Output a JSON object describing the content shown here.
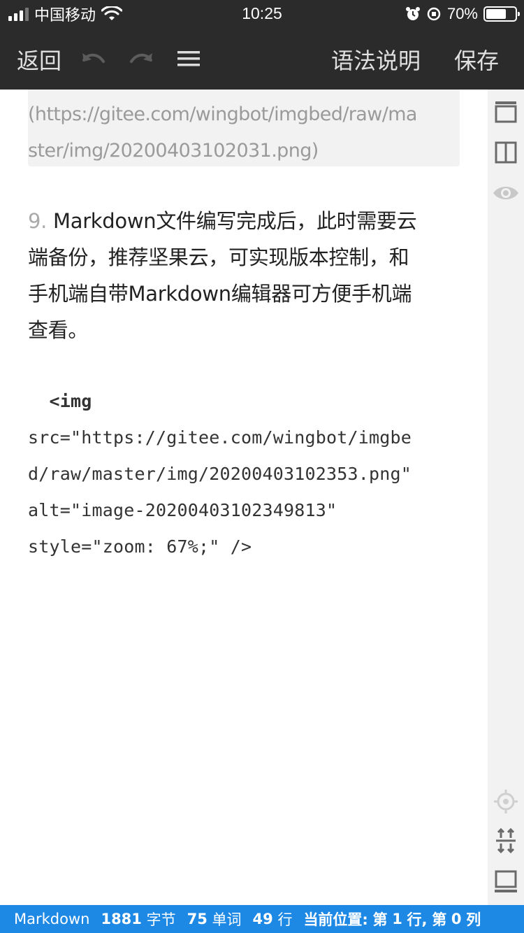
{
  "status_bar": {
    "carrier": "中国移动",
    "time": "10:25",
    "battery": "70%",
    "battery_level": 0.7
  },
  "toolbar": {
    "back_label": "返回",
    "syntax_label": "语法说明",
    "save_label": "保存"
  },
  "editor": {
    "link_lines": [
      "(https://gitee.com/wingbot/imgbed/raw/ma",
      "ster/img/20200403102031.png)"
    ],
    "paragraph": {
      "number": "9.",
      "lines": [
        " Markdown文件编写完成后，此时需要云",
        "端备份，推荐坚果云，可实现版本控制，和",
        "手机端自带Markdown编辑器可方便手机端",
        "查看。"
      ]
    },
    "code": {
      "tag": "<img",
      "lines": [
        "src=\"https://gitee.com/wingbot/imgbe",
        "d/raw/master/img/20200403102353.png\"",
        "alt=\"image-20200403102349813\"",
        "style=\"zoom: 67%;\" />"
      ]
    }
  },
  "footer": {
    "mode": "Markdown",
    "bytes_value": "1881",
    "bytes_label": "字节",
    "words_value": "75",
    "words_label": "单词",
    "lines_value": "49",
    "lines_label": "行",
    "position_label": "当前位置:",
    "position_row_prefix": "第",
    "position_row_value": "1",
    "position_row_suffix": "行,",
    "position_col_prefix": "第",
    "position_col_value": "0",
    "position_col_suffix": "列"
  },
  "colors": {
    "toolbar_bg": "#2b2b2b",
    "footer_bg": "#1e88e5",
    "side_bg": "#f2f2f2"
  }
}
